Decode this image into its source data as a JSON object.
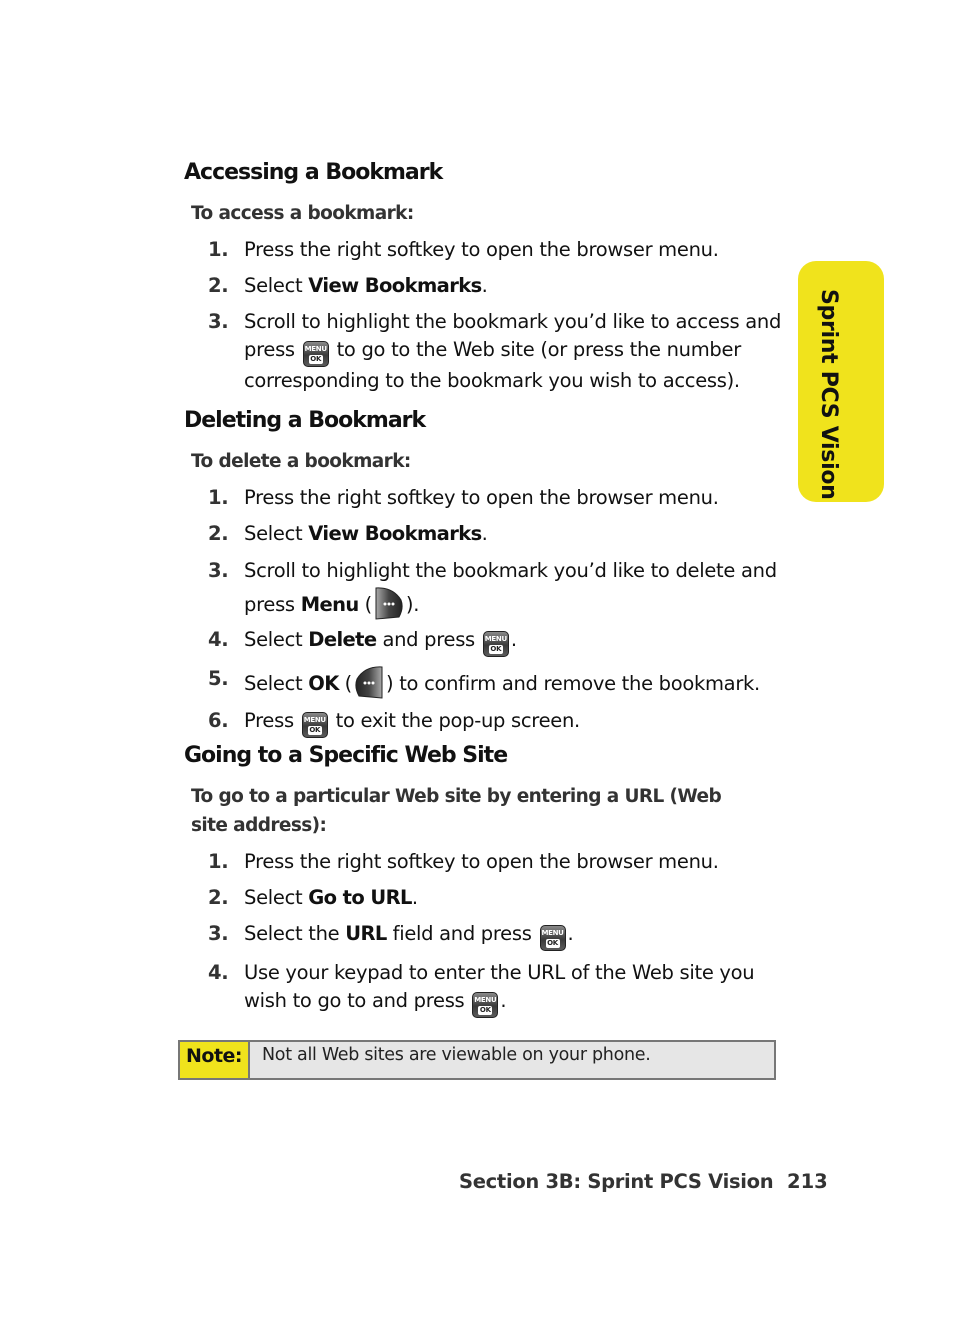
{
  "side_tab": {
    "label": "Sprint PCS Vision",
    "color": "#f0e31c"
  },
  "sections": [
    {
      "heading": "Accessing a Bookmark",
      "intro": "To access a bookmark:",
      "steps": [
        {
          "num": "1.",
          "text": "Press the right softkey to open the browser menu."
        },
        {
          "num": "2.",
          "pre": "Select ",
          "bold": "View Bookmarks",
          "post": "."
        },
        {
          "num": "3.",
          "pre": "Scroll to highlight the bookmark you’d like to access and press ",
          "icon": "menu-ok-key",
          "post": " to go to the Web site (or press the number corresponding to the bookmark you wish to access)."
        }
      ]
    },
    {
      "heading": "Deleting a Bookmark",
      "intro": "To delete a bookmark:",
      "steps": [
        {
          "num": "1.",
          "text": "Press the right softkey to open the browser menu."
        },
        {
          "num": "2.",
          "pre": "Select ",
          "bold": "View Bookmarks",
          "post": "."
        },
        {
          "num": "3.",
          "pre": "Scroll to highlight the bookmark you’d like to delete and press ",
          "bold": "Menu",
          "mid": " (",
          "icon": "right-softkey",
          "post": ")."
        },
        {
          "num": "4.",
          "pre": "Select ",
          "bold": "Delete",
          "mid": " and press ",
          "icon": "menu-ok-key",
          "post": "."
        },
        {
          "num": "5.",
          "pre": "Select ",
          "bold": "OK",
          "mid": " (",
          "icon": "left-softkey",
          "post": ") to confirm and remove the bookmark."
        },
        {
          "num": "6.",
          "pre": "Press ",
          "icon": "menu-ok-key",
          "post": " to exit the pop-up screen."
        }
      ]
    },
    {
      "heading": "Going to a Specific Web Site",
      "intro": "To go to a particular Web site by entering a URL (Web site address):",
      "steps": [
        {
          "num": "1.",
          "text": "Press the right softkey to open the browser menu."
        },
        {
          "num": "2.",
          "pre": "Select ",
          "bold": "Go to URL",
          "post": "."
        },
        {
          "num": "3.",
          "pre": "Select the ",
          "bold": "URL",
          "mid": " field and press ",
          "icon": "menu-ok-key",
          "post": "."
        },
        {
          "num": "4.",
          "pre": "Use your keypad to enter the URL of the Web site you wish to go to and press ",
          "icon": "menu-ok-key",
          "post": "."
        }
      ]
    }
  ],
  "key_labels": {
    "menu": "MENU",
    "ok": "OK"
  },
  "note": {
    "label": "Note:",
    "text": "Not all Web sites are viewable on your phone."
  },
  "footer": {
    "section": "Section 3B: Sprint PCS Vision",
    "page": "213"
  }
}
